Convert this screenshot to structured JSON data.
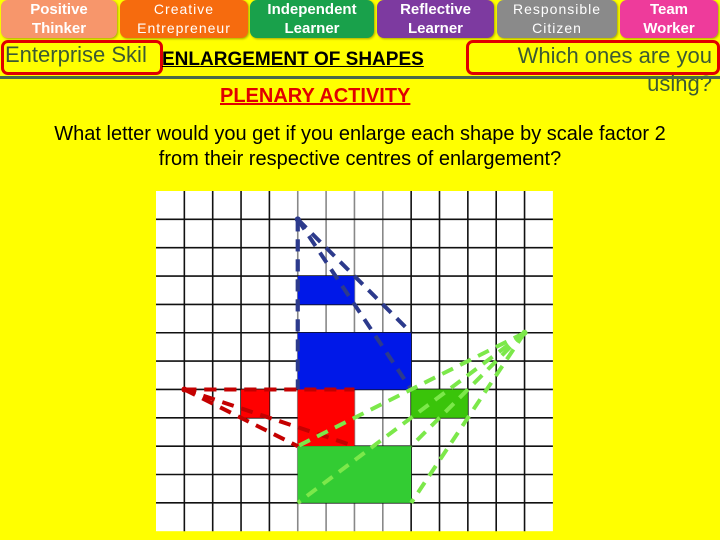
{
  "skills": [
    {
      "label_line1": "Positive",
      "label_line2": "Thinker",
      "color": "#f7966b"
    },
    {
      "label_line1": "Creative",
      "label_line2": "Entrepreneur",
      "color": "#f66b0e"
    },
    {
      "label_line1": "Independent",
      "label_line2": "Learner",
      "color": "#19a14b"
    },
    {
      "label_line1": "Reflective",
      "label_line2": "Learner",
      "color": "#7d3aa0"
    },
    {
      "label_line1": "Responsible",
      "label_line2": "Citizen",
      "color": "#8a8a8a"
    },
    {
      "label_line1": "Team",
      "label_line2": "Worker",
      "color": "#ee3b9b"
    }
  ],
  "header": {
    "enterprise_label": "Enterprise Skil",
    "title": "ENLARGEMENT OF SHAPES",
    "which_label": "Which ones are you using?",
    "subtitle": "PLENARY ACTIVITY"
  },
  "question": {
    "line1": "What letter would you get if you enlarge each shape by scale factor 2",
    "line2": "from their respective centres of enlargement?"
  },
  "diagram": {
    "grid_columns": 14,
    "grid_rows": 12,
    "scale_factor": 2,
    "shapes": [
      {
        "name": "blue",
        "color": "#0018e8",
        "line_color": "#2c3a8c",
        "centre": [
          5,
          1
        ],
        "original": {
          "col": 5,
          "row": 3,
          "w": 2,
          "h": 1
        },
        "image": {
          "col": 5,
          "row": 5,
          "w": 4,
          "h": 2
        }
      },
      {
        "name": "red",
        "color": "#ff0000",
        "line_color": "#c40000",
        "centre": [
          1,
          7
        ],
        "original": {
          "col": 3,
          "row": 7,
          "w": 1,
          "h": 1
        },
        "image": {
          "col": 5,
          "row": 7,
          "w": 2,
          "h": 2
        }
      },
      {
        "name": "green",
        "color": "#33cc33",
        "small_color": "#3ac40a",
        "line_color": "#7ce84a",
        "centre": [
          13,
          5
        ],
        "original": {
          "col": 9,
          "row": 7,
          "w": 2,
          "h": 1
        },
        "image": {
          "col": 5,
          "row": 9,
          "w": 4,
          "h": 2
        }
      }
    ]
  }
}
